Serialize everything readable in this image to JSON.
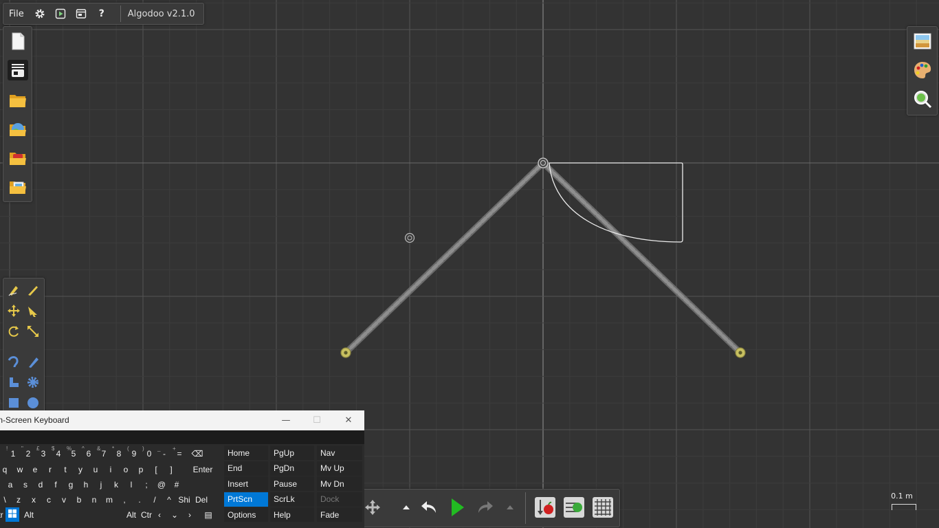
{
  "app": {
    "title": "Algodoo v2.1.0"
  },
  "menu": {
    "file_label": "File"
  },
  "colors": {
    "grid_minor": "#3d3d3d",
    "grid_major": "#555555",
    "accent_green": "#22bb22",
    "selection_blue": "#0078d7",
    "rope": "#8a8a8a"
  },
  "top_icons": [
    "gear-icon",
    "play-square-icon",
    "window-icon",
    "help-icon"
  ],
  "help_symbol": "?",
  "left_icons": [
    "new-scene-icon",
    "scene-layer-icon",
    "open-folder-icon",
    "online-browse-icon",
    "open-vehicle-folder-icon",
    "open-pictures-folder-icon"
  ],
  "right_icons": [
    "background-icon",
    "palette-icon",
    "zoom-icon"
  ],
  "scale": {
    "label": "0.1 m"
  },
  "keyboard": {
    "title": "On-Screen Keyboard",
    "row1": [
      [
        "¦",
        "1",
        "!"
      ],
      [
        "",
        "2",
        "\""
      ],
      [
        "",
        "3",
        "£"
      ],
      [
        "",
        "4",
        "$"
      ],
      [
        "",
        "5",
        "%"
      ],
      [
        "",
        "6",
        "^"
      ],
      [
        "",
        "7",
        "&"
      ],
      [
        "",
        "8",
        "*"
      ],
      [
        "",
        "9",
        "("
      ],
      [
        "",
        "0",
        ")"
      ],
      [
        "",
        "-",
        "_"
      ],
      [
        "",
        "=",
        "+"
      ]
    ],
    "row2": [
      "q",
      "w",
      "e",
      "r",
      "t",
      "y",
      "u",
      "i",
      "o",
      "p"
    ],
    "row2_extra": [
      "[",
      "]"
    ],
    "row3": [
      "a",
      "s",
      "d",
      "f",
      "g",
      "h",
      "j",
      "k",
      "l"
    ],
    "row3_extra": [
      ";",
      "@",
      "#"
    ],
    "row4": [
      "z",
      "x",
      "c",
      "v",
      "b",
      "n",
      "m"
    ],
    "row4_extra": [
      ",",
      ".",
      "/"
    ],
    "enter": "Enter",
    "shift": "Shi",
    "del": "Del",
    "alt": "Alt",
    "alt2": "Alt",
    "ctrl": "Ctr",
    "ctrl_left": "tr",
    "backslash": "\\",
    "nav_keys": [
      [
        {
          "label": "Home"
        },
        {
          "label": "PgUp"
        },
        {
          "label": "Nav"
        }
      ],
      [
        {
          "label": "End"
        },
        {
          "label": "PgDn"
        },
        {
          "label": "Mv Up"
        }
      ],
      [
        {
          "label": "Insert"
        },
        {
          "label": "Pause"
        },
        {
          "label": "Mv Dn"
        }
      ],
      [
        {
          "label": "PrtScn",
          "active": true
        },
        {
          "label": "ScrLk"
        },
        {
          "label": "Dock",
          "dim": true
        }
      ],
      [
        {
          "label": "Options"
        },
        {
          "label": "Help"
        },
        {
          "label": "Fade"
        }
      ]
    ]
  }
}
